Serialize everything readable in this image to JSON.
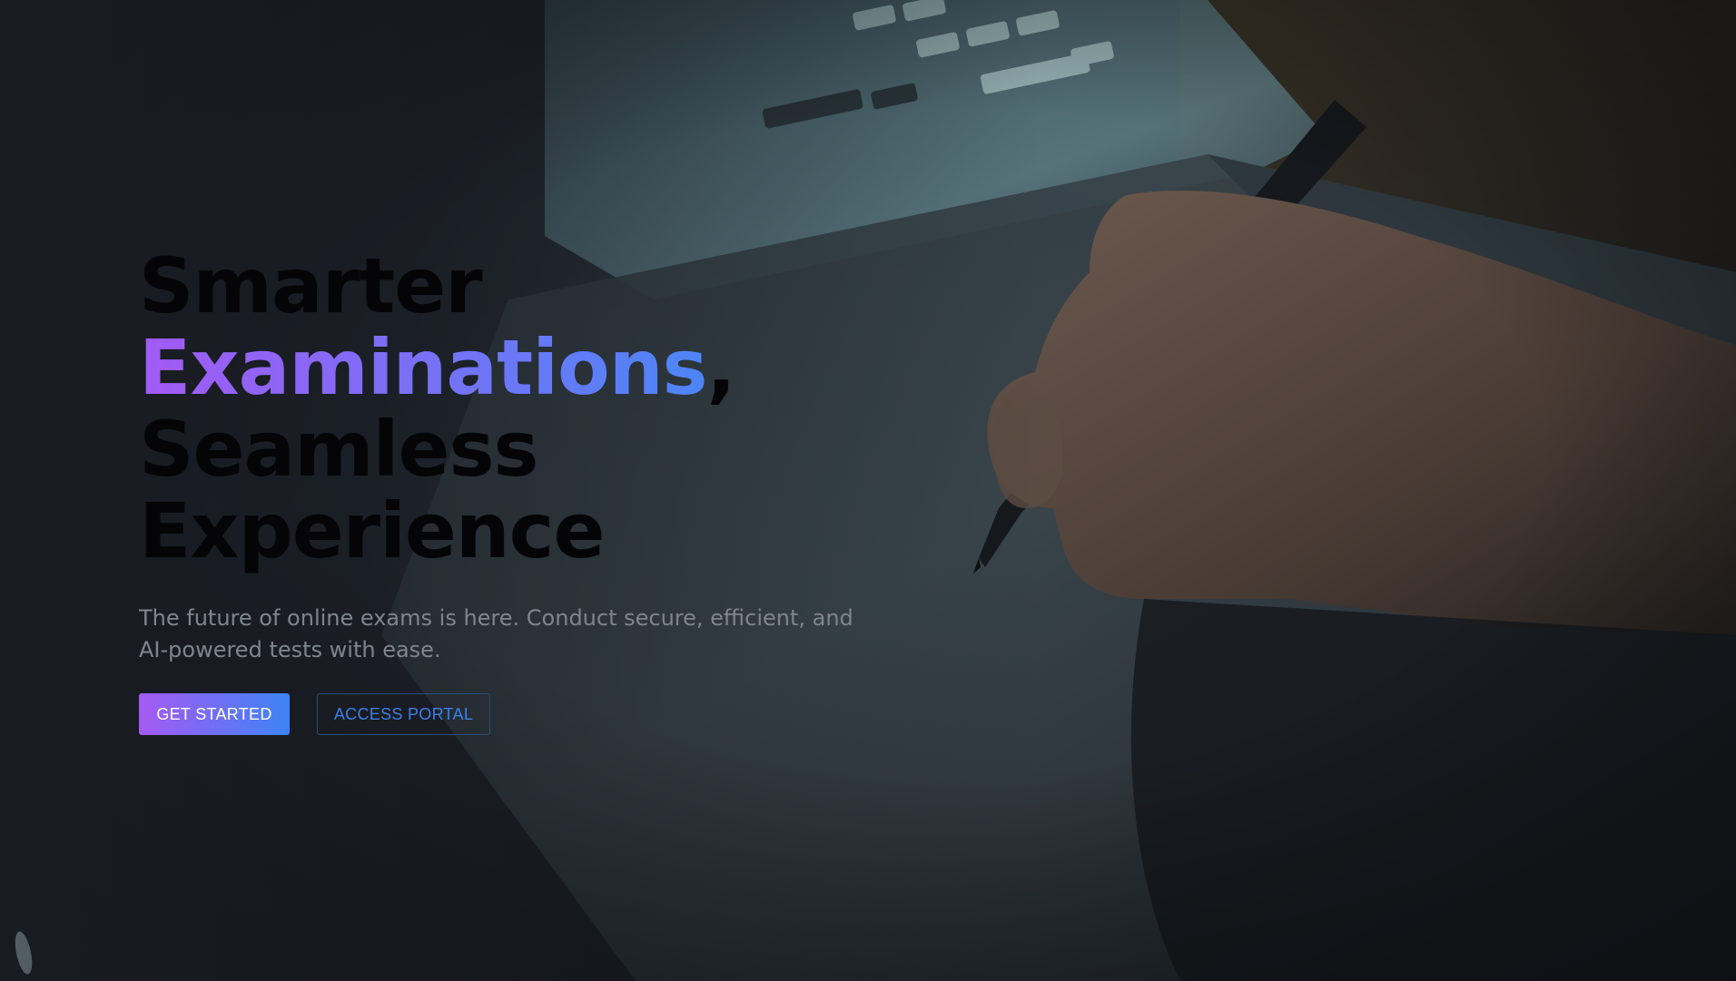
{
  "hero": {
    "headline": {
      "line1": "Smarter",
      "line2_highlight": "Examinations",
      "line2_punct": ",",
      "line3": "Seamless",
      "line4": "Experience"
    },
    "subtitle": "The future of online exams is here. Conduct secure, efficient, and AI-powered tests with ease.",
    "buttons": {
      "primary": "GET STARTED",
      "secondary": "ACCESS PORTAL"
    }
  },
  "colors": {
    "background": "#1a1d24",
    "gradient_start": "#a55af3",
    "gradient_end": "#3d84f5",
    "outline_text": "#3d7fe8",
    "subtitle_text": "#7f858d"
  },
  "background_image": "hand-writing-with-stylus-on-tablet-photo"
}
